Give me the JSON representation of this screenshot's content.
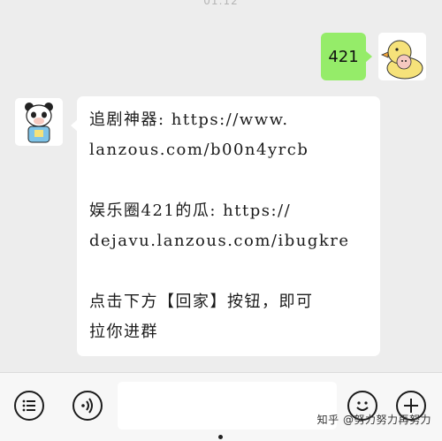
{
  "status_bar": {
    "time": "01:12"
  },
  "messages": {
    "me": {
      "text": "421"
    },
    "other": {
      "lines": [
        "追剧神器: https://www.",
        "lanzous.com/b00n4yrcb",
        "娱乐圈421的瓜: https://",
        "dejavu.lanzous.com/ibugkre",
        "点击下方【回家】按钮，即可",
        "拉你进群"
      ]
    }
  },
  "toolbar": {
    "menu_icon": "list-menu-icon",
    "voice_icon": "voice-icon",
    "emoji_icon": "emoji-icon",
    "plus_icon": "plus-icon",
    "input_value": ""
  },
  "watermark": {
    "text": "知乎 @努力努力再努力"
  },
  "colors": {
    "bubble_me": "#95ec69",
    "bubble_other": "#ffffff",
    "background": "#ededed"
  }
}
